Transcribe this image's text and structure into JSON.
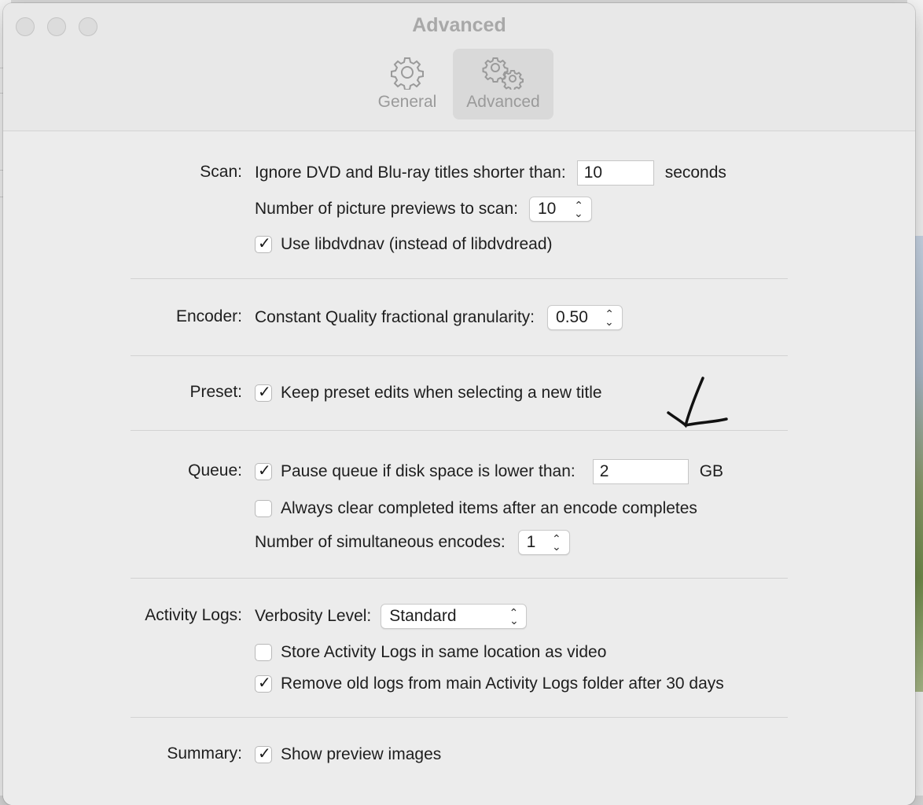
{
  "window": {
    "title": "Advanced"
  },
  "tabs": [
    {
      "label": "General",
      "icon": "gear-icon",
      "selected": false
    },
    {
      "label": "Advanced",
      "icon": "gears-icon",
      "selected": true
    }
  ],
  "scan": {
    "label": "Scan:",
    "ignore_text": "Ignore DVD and Blu-ray titles shorter than:",
    "ignore_value": "10",
    "ignore_unit": "seconds",
    "previews_text": "Number of picture previews to scan:",
    "previews_value": "10",
    "libdvdnav_text": "Use libdvdnav (instead of libdvdread)",
    "libdvdnav_checked": true
  },
  "encoder": {
    "label": "Encoder:",
    "granularity_text": "Constant Quality fractional granularity:",
    "granularity_value": "0.50"
  },
  "preset": {
    "label": "Preset:",
    "keep_text": "Keep preset edits when selecting a new title",
    "keep_checked": true
  },
  "queue": {
    "label": "Queue:",
    "pause_text": "Pause queue if disk space is lower than:",
    "pause_checked": true,
    "pause_value": "2",
    "pause_unit": "GB",
    "clear_text": "Always clear completed items after an encode completes",
    "clear_checked": false,
    "simultaneous_text": "Number of simultaneous encodes:",
    "simultaneous_value": "1"
  },
  "logs": {
    "label": "Activity Logs:",
    "verbosity_text": "Verbosity Level:",
    "verbosity_value": "Standard",
    "store_text": "Store Activity Logs in same location as video",
    "store_checked": false,
    "remove_text": "Remove old logs from main Activity Logs folder after 30 days",
    "remove_checked": true
  },
  "summary": {
    "label": "Summary:",
    "preview_text": "Show preview images",
    "preview_checked": true
  },
  "colors": {
    "window_bg": "#ececec",
    "titlebar_bg": "#e8e8e8",
    "selected_tab_bg": "#d9d9d9",
    "annotation_ink": "#111111"
  }
}
